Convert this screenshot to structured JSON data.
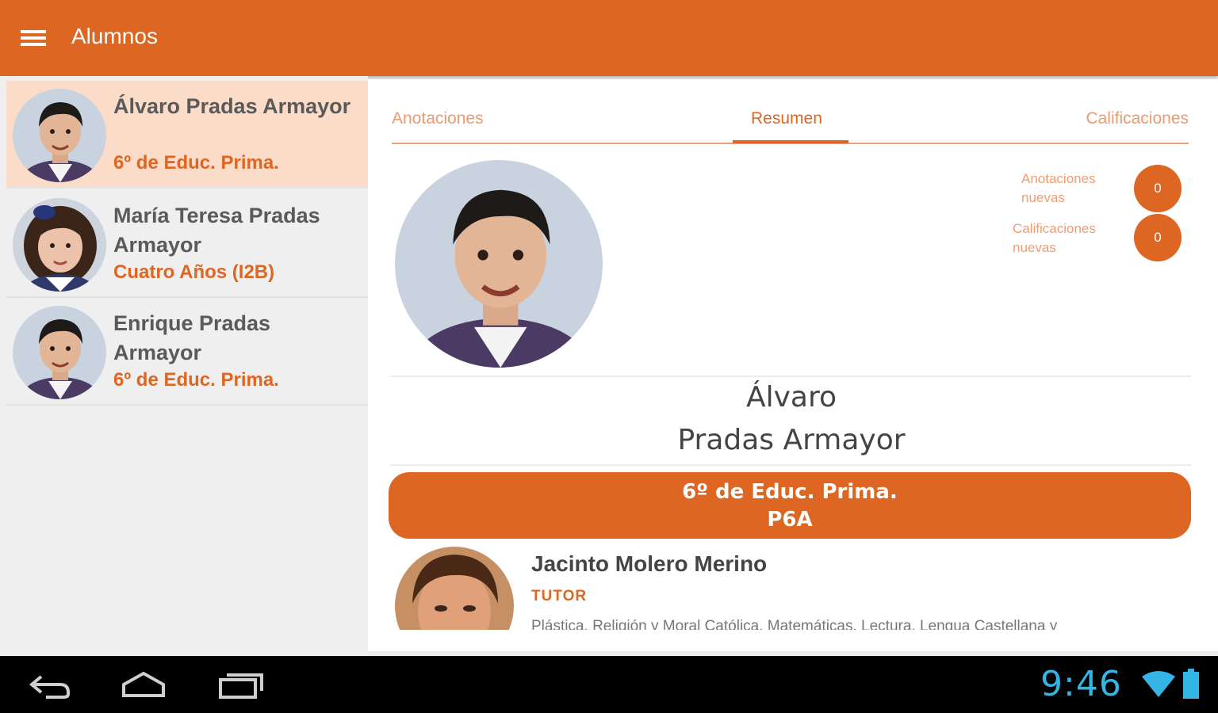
{
  "app_bar": {
    "title": "Alumnos",
    "menu_icon": "hamburger-menu-icon",
    "color": "#dc6622"
  },
  "students": [
    {
      "name": "Álvaro Pradas Armayor",
      "course": "6º de Educ. Prima.",
      "selected": true
    },
    {
      "name": "María Teresa Pradas Armayor",
      "course": "Cuatro Años (I2B)",
      "selected": false
    },
    {
      "name": "Enrique Pradas Armayor",
      "course": "6º de Educ. Prima.",
      "selected": false
    }
  ],
  "tabs": [
    {
      "label": "Anotaciones",
      "active": false
    },
    {
      "label": "Resumen",
      "active": true
    },
    {
      "label": "Calificaciones",
      "active": false
    }
  ],
  "counters": {
    "annotations": {
      "label": "Anotaciones nuevas",
      "value": "0"
    },
    "grades": {
      "label": "Calificaciones nuevas",
      "value": "0"
    }
  },
  "profile": {
    "first_name": "Álvaro",
    "last_name": "Pradas Armayor",
    "course": "6º de Educ. Prima.",
    "group": "P6A"
  },
  "tutor": {
    "name": "Jacinto Molero Merino",
    "role": "TUTOR",
    "subjects": "Plástica, Religión y Moral Católica, Matemáticas, Lectura, Lengua Castellana y"
  },
  "system_bar": {
    "time": "9:46",
    "icons": [
      "back-icon",
      "home-icon",
      "recent-apps-icon",
      "wifi-icon",
      "battery-icon"
    ]
  }
}
